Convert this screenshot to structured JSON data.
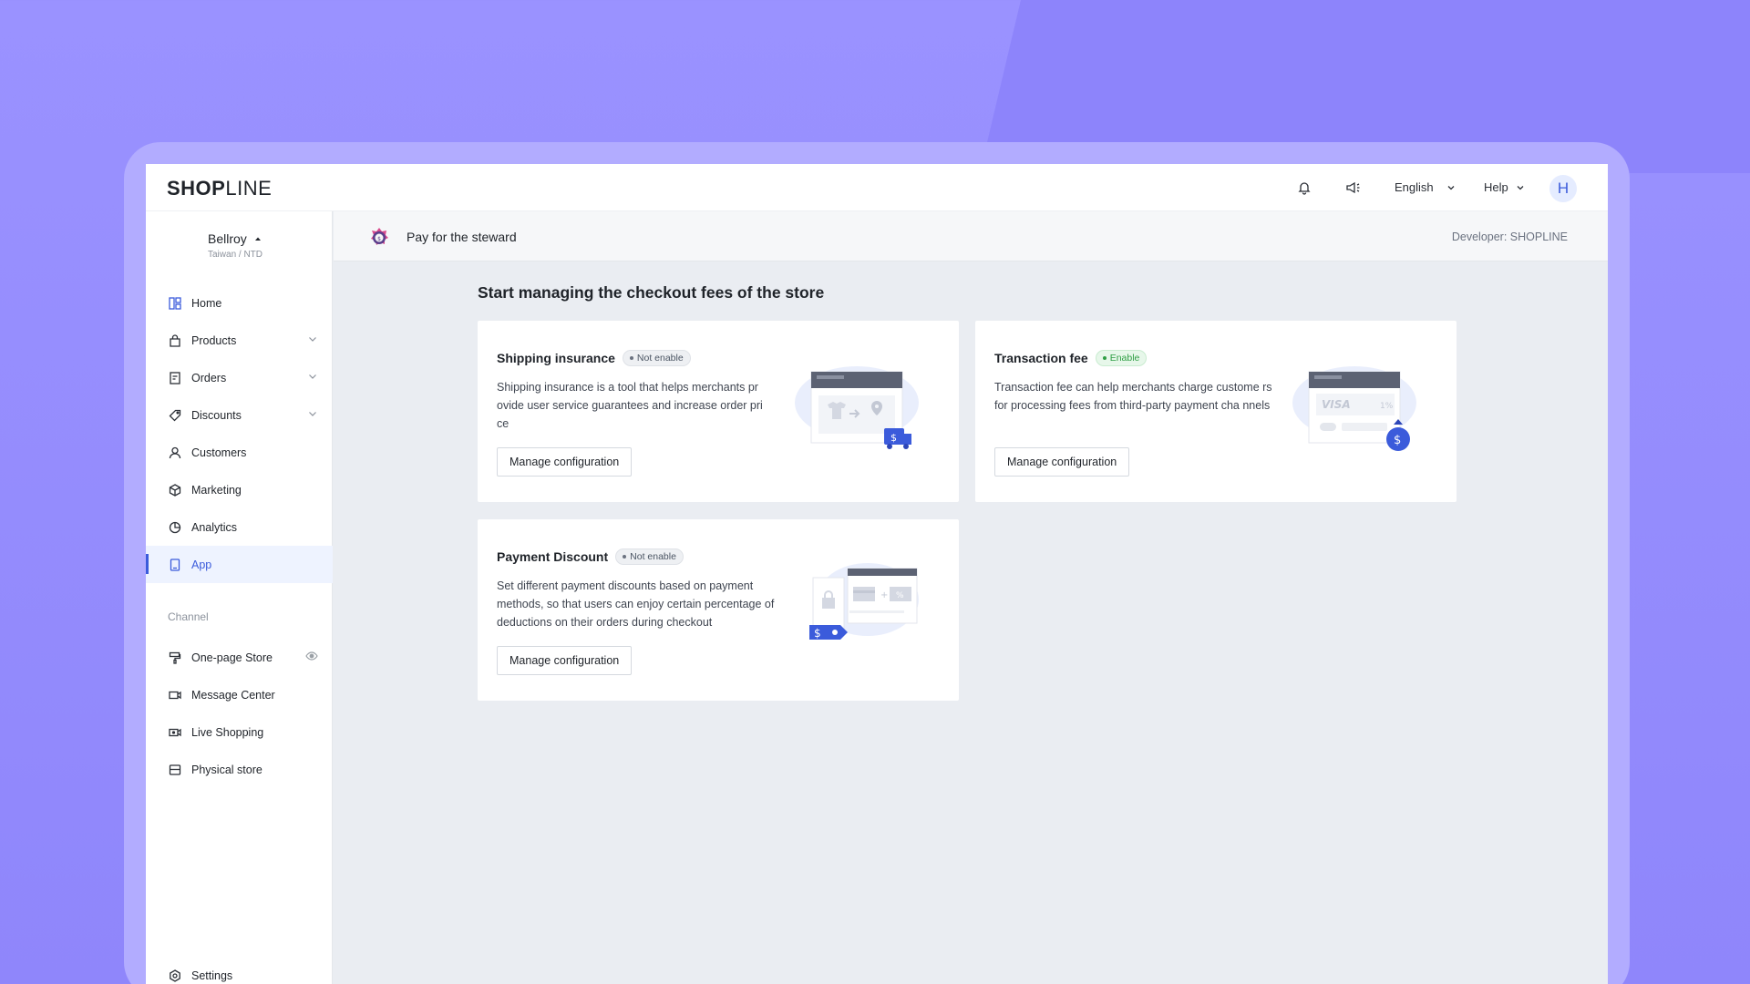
{
  "header": {
    "logo_bold": "SHOP",
    "logo_thin": "LINE",
    "language": "English",
    "help": "Help",
    "avatar_initial": "H"
  },
  "sidebar": {
    "store_name": "Bellroy",
    "store_region": "Taiwan / NTD",
    "items": [
      {
        "label": "Home",
        "icon": "dashboard-icon",
        "has_chevron": false
      },
      {
        "label": "Products",
        "icon": "bag-icon",
        "has_chevron": true
      },
      {
        "label": "Orders",
        "icon": "orders-icon",
        "has_chevron": true
      },
      {
        "label": "Discounts",
        "icon": "tag-icon",
        "has_chevron": true
      },
      {
        "label": "Customers",
        "icon": "user-icon",
        "has_chevron": false
      },
      {
        "label": "Marketing",
        "icon": "cube-icon",
        "has_chevron": false
      },
      {
        "label": "Analytics",
        "icon": "pie-chart-icon",
        "has_chevron": false
      },
      {
        "label": "App",
        "icon": "app-icon",
        "has_chevron": false,
        "active": true
      }
    ],
    "channel_label": "Channel",
    "channels": [
      {
        "label": "One-page Store",
        "icon": "paint-roller-icon"
      },
      {
        "label": "Message Center",
        "icon": "video-icon"
      },
      {
        "label": "Live Shopping",
        "icon": "live-video-icon"
      },
      {
        "label": "Physical store",
        "icon": "store-icon"
      }
    ],
    "settings_label": "Settings"
  },
  "appbar": {
    "title": "Pay for the steward",
    "developer": "Developer: SHOPLINE"
  },
  "main": {
    "page_title": "Start managing the checkout fees of the store",
    "cards": [
      {
        "title": "Shipping insurance",
        "status": "Not enable",
        "description": "Shipping insurance is a tool that helps merchants pr ovide user service guarantees and increase order pri ce",
        "button": "Manage configuration"
      },
      {
        "title": "Transaction fee",
        "status": "Enable",
        "description": "Transaction fee can help merchants charge custome rs for processing fees from third-party payment cha nnels",
        "button": "Manage configuration",
        "visa_label": "VISA",
        "percent_label": "1%"
      },
      {
        "title": "Payment Discount",
        "status": "Not enable",
        "description": "Set different payment discounts based on payment methods, so that users can enjoy certain percentage of deductions on their orders during checkout",
        "button": "Manage configuration",
        "percent_label": "%"
      }
    ]
  },
  "colors": {
    "accent": "#3b5bdb",
    "enable_green": "#2f9e44",
    "background": "#9a92ff"
  }
}
